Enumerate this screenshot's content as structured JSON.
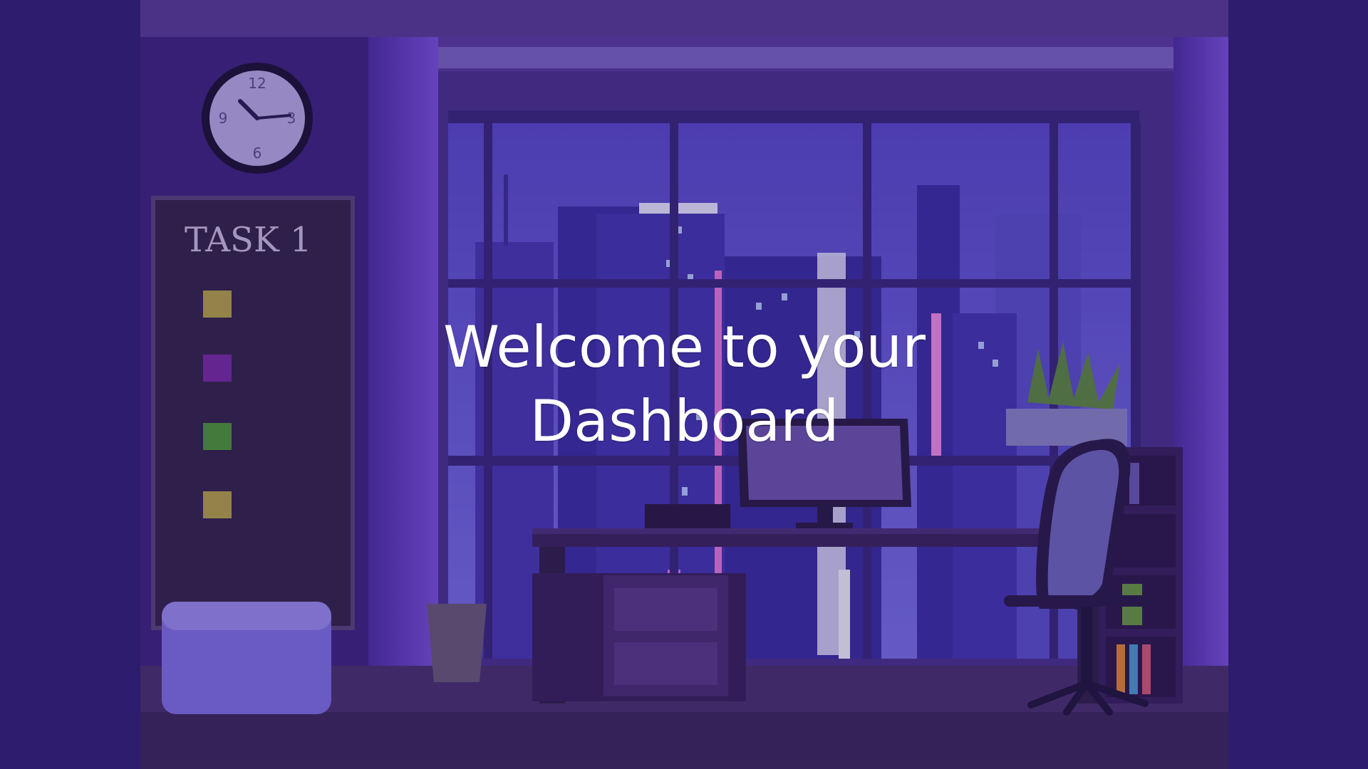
{
  "welcome": {
    "line1": "Welcome to your",
    "line2": "Dashboard"
  },
  "background": {
    "board_label": "TASK 1",
    "clock_numerals": {
      "n12": "12",
      "n3": "3",
      "n6": "6",
      "n9": "9"
    }
  },
  "colors": {
    "side_panels": "#2e1c6e",
    "welcome_text": "#ffffff"
  }
}
